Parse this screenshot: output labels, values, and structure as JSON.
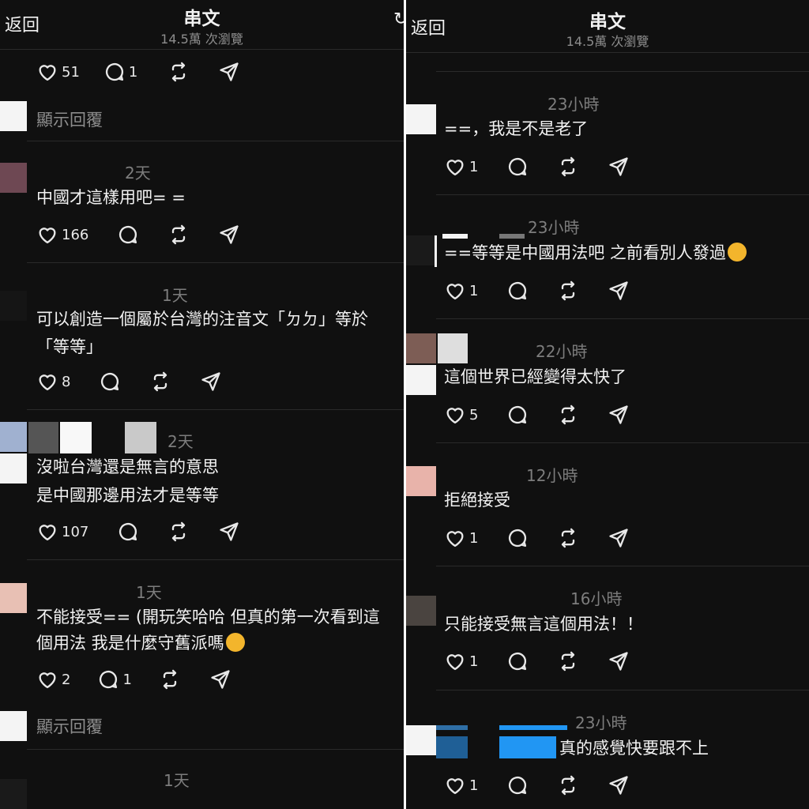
{
  "left": {
    "header": {
      "back": "返回",
      "title": "串文",
      "views": "14.5萬 次瀏覽"
    },
    "top_actions": {
      "likes": "51",
      "replies": "1"
    },
    "show_replies_1": "顯示回覆",
    "posts": [
      {
        "time": "2天",
        "lines": [
          "中國才這樣用吧= ="
        ],
        "likes": "166",
        "replies": ""
      },
      {
        "time": "1天",
        "lines": [
          "可以創造一個屬於台灣的注音文「ㄉㄉ」等於",
          "「等等」"
        ],
        "likes": "8",
        "replies": ""
      },
      {
        "time": "2天",
        "lines": [
          "沒啦台灣還是無言的意思",
          "是中國那邊用法才是等等"
        ],
        "likes": "107",
        "replies": ""
      },
      {
        "time": "1天",
        "lines": [
          "不能接受== (開玩笑哈哈 但真的第一次看到這",
          "個用法 我是什麼守舊派嗎"
        ],
        "likes": "2",
        "replies": "1"
      }
    ],
    "show_replies_2": "顯示回覆",
    "last_time": "1天"
  },
  "right": {
    "header": {
      "back": "返回",
      "title": "串文",
      "views": "14.5萬 次瀏覽"
    },
    "posts": [
      {
        "time": "23小時",
        "text": "==，我是不是老了",
        "likes": "1"
      },
      {
        "time": "23小時",
        "text": "==等等是中國用法吧 之前看別人發過",
        "likes": "1"
      },
      {
        "time": "22小時",
        "text": "這個世界已經變得太快了",
        "likes": "5"
      },
      {
        "time": "12小時",
        "text": "拒絕接受",
        "likes": "1"
      },
      {
        "time": "16小時",
        "text": "只能接受無言這個用法！！",
        "likes": "1"
      },
      {
        "time": "23小時",
        "text": "真的感覺快要跟不上",
        "likes": "1"
      }
    ]
  },
  "icons": [
    "heart-icon",
    "comment-icon",
    "repost-icon",
    "share-icon",
    "thinking-emoji",
    "pensive-emoji"
  ],
  "colors": {
    "background": "#101010",
    "text": "#f2f2f2",
    "muted": "#8d8d8d",
    "censor_blue": "#2196f3"
  }
}
